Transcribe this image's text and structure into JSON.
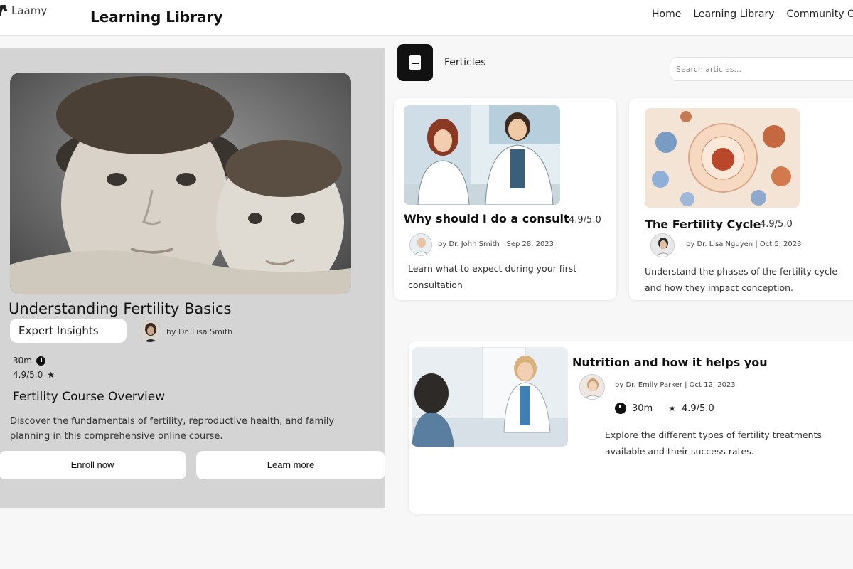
{
  "header": {
    "logo_text": "Laamy",
    "title": "Learning Library",
    "nav": [
      "Home",
      "Learning Library",
      "Community O"
    ]
  },
  "featured": {
    "title": "Understanding Fertility Basics",
    "tag": "Expert Insights",
    "instructor": "by Dr. Lisa Smith",
    "duration": "30m",
    "rating": "4.9/5.0",
    "overview_title": "Fertility Course Overview",
    "description": "Discover the fundamentals of fertility, reproductive health, and family planning in this comprehensive online course.",
    "enroll_label": "Enroll now",
    "learn_label": "Learn more"
  },
  "articles": {
    "label": "Ferticles",
    "search_placeholder": "Search articles...",
    "items": [
      {
        "title": "Why should I do a consult",
        "rating": "4.9/5.0",
        "meta": "by Dr. John Smith | Sep 28, 2023",
        "description": "Learn what to expect during your first consultation"
      },
      {
        "title": "The Fertility Cycle",
        "rating": "4.9/5.0",
        "meta": "by Dr. Lisa Nguyen | Oct 5, 2023",
        "description": "Understand the phases of the fertility cycle and how they impact conception."
      },
      {
        "title": "Nutrition and how it helps you",
        "meta": "by Dr. Emily Parker | Oct 12, 2023",
        "duration": "30m",
        "rating": "4.9/5.0",
        "description": "Explore the different types of fertility treatments available and their success rates."
      }
    ]
  }
}
